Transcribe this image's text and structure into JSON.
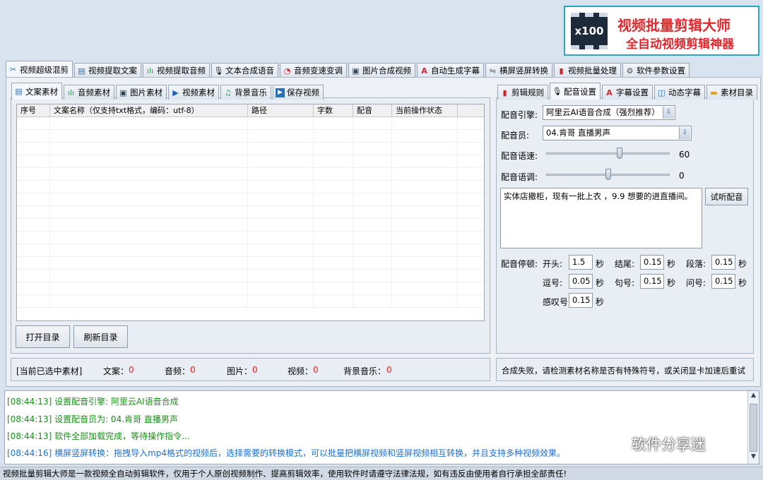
{
  "banner": {
    "logo_text": "x100",
    "title": "视频批量剪辑大师",
    "subtitle": "全自动视频剪辑神器"
  },
  "main_tabs": [
    {
      "label": "视频超级混剪",
      "icon": "scissors-icon",
      "active": true
    },
    {
      "label": "视频提取文案",
      "icon": "document-icon"
    },
    {
      "label": "视频提取音频",
      "icon": "audio-wave-icon"
    },
    {
      "label": "文本合成语音",
      "icon": "microphone-icon"
    },
    {
      "label": "音频变速变调",
      "icon": "gauge-icon"
    },
    {
      "label": "图片合成视频",
      "icon": "image-icon"
    },
    {
      "label": "自动生成字幕",
      "icon": "font-icon"
    },
    {
      "label": "横屏竖屏转换",
      "icon": "rotate-screen-icon"
    },
    {
      "label": "视频批量处理",
      "icon": "film-icon"
    },
    {
      "label": "软件参数设置",
      "icon": "gear-icon"
    }
  ],
  "sub_tabs": [
    {
      "label": "文案素材",
      "icon": "document-icon",
      "active": true
    },
    {
      "label": "音频素材",
      "icon": "audio-wave-icon"
    },
    {
      "label": "图片素材",
      "icon": "image-icon"
    },
    {
      "label": "视频素材",
      "icon": "play-icon"
    },
    {
      "label": "背景音乐",
      "icon": "music-note-icon"
    },
    {
      "label": "保存视频",
      "icon": "save-icon"
    }
  ],
  "table": {
    "columns": [
      "序号",
      "文案名称（仅支持txt格式，编码：utf-8）",
      "路径",
      "字数",
      "配音",
      "当前操作状态"
    ]
  },
  "buttons": {
    "open_dir": "打开目录",
    "refresh_dir": "刷新目录",
    "test_voice": "试听配音"
  },
  "selected": {
    "label": "[当前已选中素材]",
    "items": [
      {
        "label": "文案：",
        "value": "0"
      },
      {
        "label": "音频：",
        "value": "0"
      },
      {
        "label": "图片：",
        "value": "0"
      },
      {
        "label": "视频：",
        "value": "0"
      },
      {
        "label": "背景音乐：",
        "value": "0"
      }
    ]
  },
  "right_tabs": [
    {
      "label": "剪辑规则",
      "icon": "film-icon"
    },
    {
      "label": "配音设置",
      "icon": "microphone-icon",
      "active": true
    },
    {
      "label": "字幕设置",
      "icon": "font-icon"
    },
    {
      "label": "动态字幕",
      "icon": "text-box-icon"
    },
    {
      "label": "素材目录",
      "icon": "folder-icon"
    }
  ],
  "voice": {
    "engine_label": "配音引擎:",
    "engine_value": "阿里云AI语音合成（强烈推荐）",
    "speaker_label": "配音员:",
    "speaker_value": "04.肯哥 直播男声",
    "speed_label": "配音语速:",
    "speed_value": "60",
    "speed_level": 0.6,
    "pitch_label": "配音语调:",
    "pitch_value": "0",
    "pitch_level": 0.5,
    "text": "实体店撤柜，现有一批上衣 ，9.9 想要的进直播间。",
    "pause_label": "配音停顿:",
    "pauses": [
      {
        "label": "开头:",
        "value": "1.5",
        "unit": "秒"
      },
      {
        "label": "结尾:",
        "value": "0.15",
        "unit": "秒"
      },
      {
        "label": "段落:",
        "value": "0.15",
        "unit": "秒"
      },
      {
        "label": "逗号:",
        "value": "0.05",
        "unit": "秒"
      },
      {
        "label": "句号:",
        "value": "0.15",
        "unit": "秒"
      },
      {
        "label": "问号:",
        "value": "0.15",
        "unit": "秒"
      },
      {
        "label": "感叹号:",
        "value": "0.15",
        "unit": "秒"
      }
    ]
  },
  "status_message": "合成失败，请检测素材名称是否有特殊符号，或关闭显卡加速后重试",
  "log": [
    {
      "text": "[08:44:13] 设置配音引擎:   阿里云AI语音合成",
      "color": "#1a8f1a"
    },
    {
      "text": "[08:44:13] 设置配音员为: 04.肯哥 直播男声",
      "color": "#1a8f1a"
    },
    {
      "text": "[08:44:13] 软件全部加载完成，等待操作指令...",
      "color": "#1a8f1a"
    },
    {
      "text": "[08:44:16] 横屏竖屏转换：拖拽导入mp4格式的视频后，选择需要的转换模式，可以批量把横屏视频和竖屏视频相互转换，并且支持多种视频效果。",
      "color": "#1f6fd1"
    }
  ],
  "footer": "视频批量剪辑大师是一款视频全自动剪辑软件，仅用于个人原创视频制作、提高剪辑效率，使用软件时请遵守法律法规，如有违反由使用者自行承担全部责任!",
  "watermark": "软件分享迷"
}
